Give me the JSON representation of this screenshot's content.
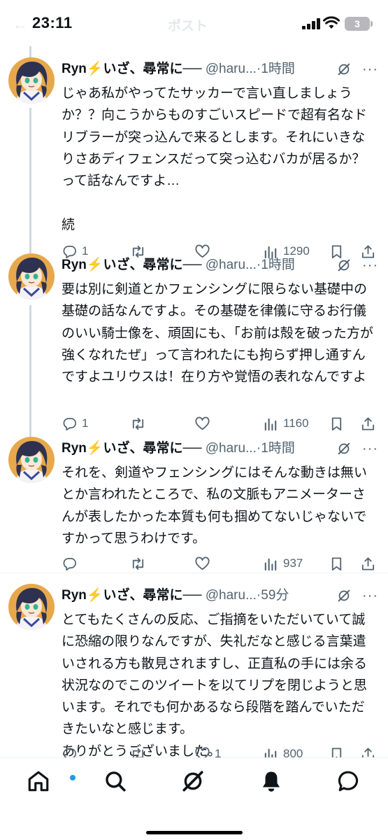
{
  "status_bar": {
    "time": "23:11",
    "battery": "3",
    "nav_title": "ポスト"
  },
  "colors": {
    "text": "#0f1419",
    "muted": "#536471",
    "accent": "#1d9bf0",
    "divider": "#eff3f4"
  },
  "tweets": [
    {
      "name": "Ryn⚡️いざ、尋常に──",
      "handle": "@haru...",
      "time": "1時間",
      "body": "じゃあ私がやってたサッカーで言い直しましょうか？？向こうからものすごいスピードで超有名なドリブラーが突っ込んで来るとします。それにいきなりさあディフェンスだって突っ込むバカが居るか？って話なんですよ…\n\n続",
      "replies": "1",
      "reposts": "",
      "likes": "",
      "views": "1290"
    },
    {
      "name": "Ryn⚡️いざ、尋常に──",
      "handle": "@haru...",
      "time": "1時間",
      "body": "要は別に剣道とかフェンシングに限らない基礎中の基礎の話なんですよ。その基礎を律儀に守るお行儀のいい騎士像を、頑固にも、「お前は殻を破った方が強くなれたぜ」って言われたにも拘らず押し通すんですよユリウスは！在り方や覚悟の表れなんですよ",
      "replies": "1",
      "reposts": "",
      "likes": "",
      "views": "1160"
    },
    {
      "name": "Ryn⚡️いざ、尋常に──",
      "handle": "@haru...",
      "time": "1時間",
      "body": "それを、剣道やフェンシングにはそんな動きは無いとか言われたところで、私の文脈もアニメーターさんが表したかった本質も何も掴めてないじゃないですかって思うわけです。",
      "replies": "",
      "reposts": "",
      "likes": "",
      "views": "937"
    },
    {
      "name": "Ryn⚡️いざ、尋常に──",
      "handle": "@haru...",
      "time": "59分",
      "body": "とてもたくさんの反応、ご指摘をいただいていて誠に恐縮の限りなんですが、失礼だなと感じる言葉遣いされる方も散見されますし、正直私の手には余る状況なのでこのツイートを以てリプを閉じようと思います。それでも何かあるなら段階を踏んでいただきたいなと感じます。\nありがとうございました。",
      "replies": "",
      "reposts": "",
      "likes": "1",
      "views": "800"
    }
  ],
  "bottom_nav": [
    {
      "icon": "home-icon"
    },
    {
      "icon": "search-icon"
    },
    {
      "icon": "grok-icon"
    },
    {
      "icon": "notifications-icon"
    },
    {
      "icon": "messages-icon"
    }
  ]
}
